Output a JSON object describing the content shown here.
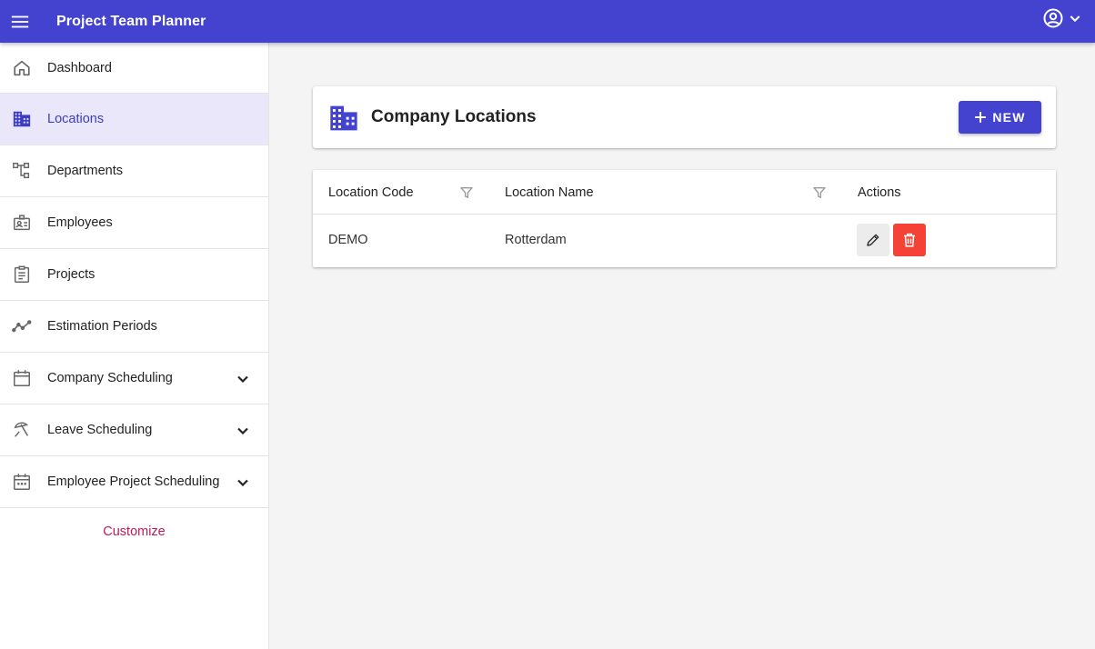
{
  "app": {
    "title": "Project Team Planner"
  },
  "icons": {
    "menu": "menu-icon",
    "account": "account-circle-icon",
    "account_chevron": "chevron-down-icon"
  },
  "colors": {
    "primary": "#4343cf",
    "active_nav_bg": "#e9e7f9",
    "delete": "#f44336",
    "customize": "#c2185b"
  },
  "sidebar": {
    "items": [
      {
        "label": "Dashboard",
        "icon": "home-icon"
      },
      {
        "label": "Locations",
        "icon": "building-icon",
        "active": true
      },
      {
        "label": "Departments",
        "icon": "hierarchy-icon"
      },
      {
        "label": "Employees",
        "icon": "badge-icon"
      },
      {
        "label": "Projects",
        "icon": "clipboard-icon"
      },
      {
        "label": "Estimation Periods",
        "icon": "trend-line-icon"
      },
      {
        "label": "Company Scheduling",
        "icon": "calendar-icon",
        "expandable": true
      },
      {
        "label": "Leave Scheduling",
        "icon": "beach-umbrella-icon",
        "expandable": true
      },
      {
        "label": "Employee Project Scheduling",
        "icon": "calendar-dots-icon",
        "expandable": true
      }
    ],
    "customize_label": "Customize"
  },
  "page": {
    "title": "Company Locations",
    "icon": "building-icon",
    "new_button_label": "NEW"
  },
  "table": {
    "columns": [
      {
        "label": "Location Code",
        "filterable": true
      },
      {
        "label": "Location Name",
        "filterable": true
      },
      {
        "label": "Actions",
        "filterable": false
      }
    ],
    "rows": [
      {
        "code": "DEMO",
        "name": "Rotterdam"
      }
    ],
    "row_actions": [
      "edit-icon",
      "trash-icon"
    ]
  }
}
